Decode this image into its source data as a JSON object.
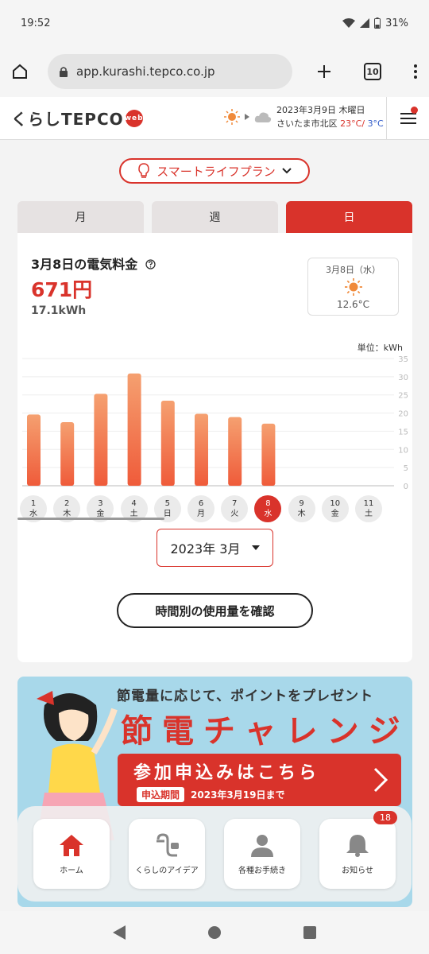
{
  "status": {
    "time": "19:52",
    "battery": "31%"
  },
  "browser": {
    "url": "app.kurashi.tepco.co.jp",
    "tab_count": "10"
  },
  "header": {
    "logo": "くらしTEPCO",
    "logo_badge": "web",
    "weather_date": "2023年3月9日 木曜日",
    "location": "さいたま市北区",
    "temp_high": "23°C/",
    "temp_low": "3°C"
  },
  "plan": {
    "label": "スマートライフプラン"
  },
  "tabs": [
    {
      "label": "月"
    },
    {
      "label": "週"
    },
    {
      "label": "日"
    }
  ],
  "summary": {
    "title": "3月8日の電気料金",
    "price": "671円",
    "usage": "17.1kWh",
    "weather_date": "3月8日（水）",
    "weather_temp": "12.6°C"
  },
  "chart_data": {
    "type": "bar",
    "ylabel": "単位：kWh",
    "ylim": [
      0,
      35
    ],
    "yticks": [
      "0",
      "5",
      "10",
      "15",
      "20",
      "25",
      "30",
      "35"
    ],
    "categories": [
      "1 水",
      "2 木",
      "3 金",
      "4 土",
      "5 日",
      "6 月",
      "7 火",
      "8 水"
    ],
    "values": [
      19.6,
      17.5,
      25.3,
      30.9,
      23.4,
      19.8,
      18.9,
      17.1
    ],
    "selected_index": 7,
    "bar_color": "#f0724a"
  },
  "dates": [
    {
      "day": "1",
      "wd": "水"
    },
    {
      "day": "2",
      "wd": "木"
    },
    {
      "day": "3",
      "wd": "金"
    },
    {
      "day": "4",
      "wd": "土"
    },
    {
      "day": "5",
      "wd": "日"
    },
    {
      "day": "6",
      "wd": "月"
    },
    {
      "day": "7",
      "wd": "火"
    },
    {
      "day": "8",
      "wd": "水"
    },
    {
      "day": "9",
      "wd": "木"
    },
    {
      "day": "10",
      "wd": "金"
    },
    {
      "day": "11",
      "wd": "土"
    }
  ],
  "month_select": {
    "value": "2023年 3月"
  },
  "hourly_button": {
    "label": "時間別の使用量を確認"
  },
  "banner": {
    "subtitle": "節電量に応じて、ポイントをプレゼント",
    "title": "節電チャレンジ",
    "cta": "参加申込みはこちら",
    "period_label": "申込期間",
    "period": "2023年3月19日まで"
  },
  "bottom_nav": [
    {
      "label": "ホーム",
      "icon": "home-icon"
    },
    {
      "label": "くらしのアイデア",
      "icon": "plug-icon"
    },
    {
      "label": "各種お手続き",
      "icon": "person-icon"
    },
    {
      "label": "お知らせ",
      "icon": "bell-icon",
      "badge": "18"
    }
  ],
  "colors": {
    "accent": "#d9332b",
    "bar": "#f0724a",
    "banner_bg": "#a8d8ea"
  }
}
